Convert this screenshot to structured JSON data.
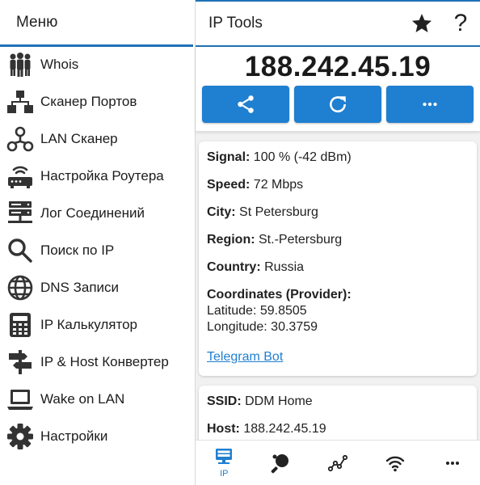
{
  "drawer": {
    "title": "Меню",
    "items": [
      {
        "label": "Whois",
        "icon": "people-icon"
      },
      {
        "label": "Сканер Портов",
        "icon": "network-tree-icon"
      },
      {
        "label": "LAN Сканер",
        "icon": "lan-nodes-icon"
      },
      {
        "label": "Настройка Роутера",
        "icon": "router-icon"
      },
      {
        "label": "Лог Соединений",
        "icon": "server-log-icon"
      },
      {
        "label": "Поиск по IP",
        "icon": "magnifier-icon"
      },
      {
        "label": "DNS Записи",
        "icon": "globe-icon"
      },
      {
        "label": "IP Калькулятор",
        "icon": "calculator-icon"
      },
      {
        "label": "IP & Host Конвертер",
        "icon": "signpost-icon"
      },
      {
        "label": "Wake on LAN",
        "icon": "laptop-icon"
      },
      {
        "label": "Настройки",
        "icon": "gear-icon"
      }
    ]
  },
  "appbar": {
    "title": "IP Tools"
  },
  "ip_card": {
    "ip": "188.242.45.19",
    "actions": [
      "share-icon",
      "refresh-icon",
      "more-icon"
    ]
  },
  "info": {
    "signal_label": "Signal:",
    "signal_value": "100 % (-42 dBm)",
    "speed_label": "Speed:",
    "speed_value": "72 Mbps",
    "city_label": "City:",
    "city_value": "St Petersburg",
    "region_label": "Region:",
    "region_value": "St.-Petersburg",
    "country_label": "Country:",
    "country_value": "Russia",
    "coords_label": "Coordinates (Provider):",
    "latitude": "Latitude: 59.8505",
    "longitude": "Longitude: 30.3759",
    "link": "Telegram Bot"
  },
  "network": {
    "ssid_label": "SSID:",
    "ssid_value": "DDM Home",
    "host_label": "Host:",
    "host_value": "188.242.45.19"
  },
  "bottom_nav": {
    "ip_label": "IP"
  },
  "colors": {
    "accent": "#1f7fd0",
    "divider": "#1f72b8"
  }
}
